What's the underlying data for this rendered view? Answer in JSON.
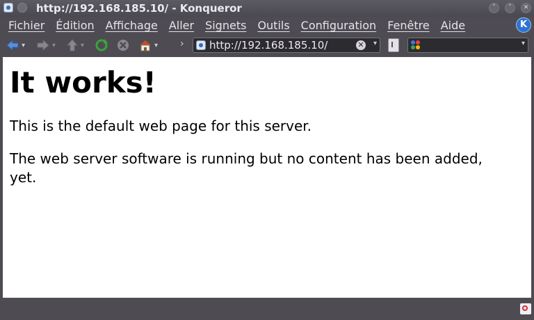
{
  "window": {
    "title": "http://192.168.185.10/ - Konqueror",
    "icon": "konqueror-icon"
  },
  "menu": {
    "items": [
      "Fichier",
      "Édition",
      "Affichage",
      "Aller",
      "Signets",
      "Outils",
      "Configuration",
      "Fenêtre",
      "Aide"
    ]
  },
  "toolbar": {
    "back_icon": "arrow-left-icon",
    "forward_icon": "arrow-right-icon",
    "up_icon": "arrow-up-icon",
    "reload_icon": "reload-icon",
    "stop_icon": "stop-icon",
    "home_icon": "home-icon",
    "location_separator": "›",
    "url": "http://192.168.185.10/",
    "search_value": ""
  },
  "page": {
    "heading": "It works!",
    "paragraphs": [
      "This is the default web page for this server.",
      "The web server software is running but no content has been added, yet."
    ]
  },
  "colors": {
    "chrome": "#4e4c52",
    "content_bg": "#ffffff",
    "accent": "#2d74d0"
  }
}
